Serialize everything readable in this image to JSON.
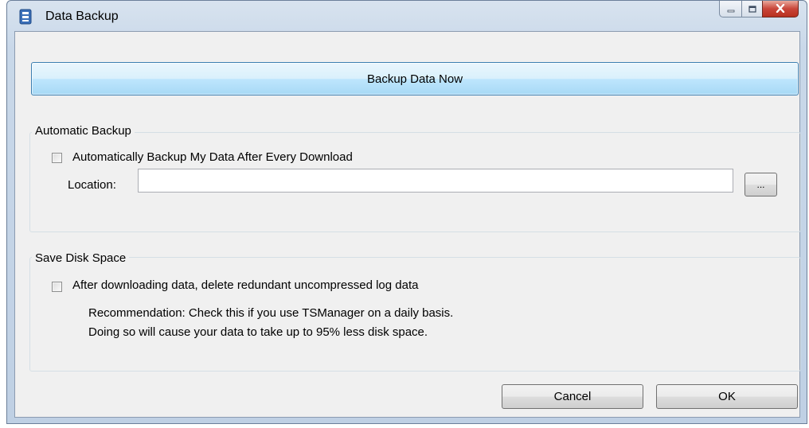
{
  "window": {
    "title": "Data Backup",
    "icon": "tsmanager-app-icon"
  },
  "backup_now_label": "Backup Data Now",
  "automatic_backup": {
    "group_label": "Automatic Backup",
    "checkbox_label": "Automatically Backup My Data After Every Download",
    "checked": false,
    "location_label": "Location:",
    "location_value": "",
    "browse_label": "..."
  },
  "save_disk_space": {
    "group_label": "Save Disk Space",
    "checkbox_label": "After downloading data, delete redundant uncompressed log data",
    "checked": false,
    "recommendation_line1": "Recommendation:  Check this if you use TSManager on a daily basis.",
    "recommendation_line2": "Doing so will cause your data to take up to 95% less disk space."
  },
  "buttons": {
    "cancel": "Cancel",
    "ok": "OK"
  }
}
